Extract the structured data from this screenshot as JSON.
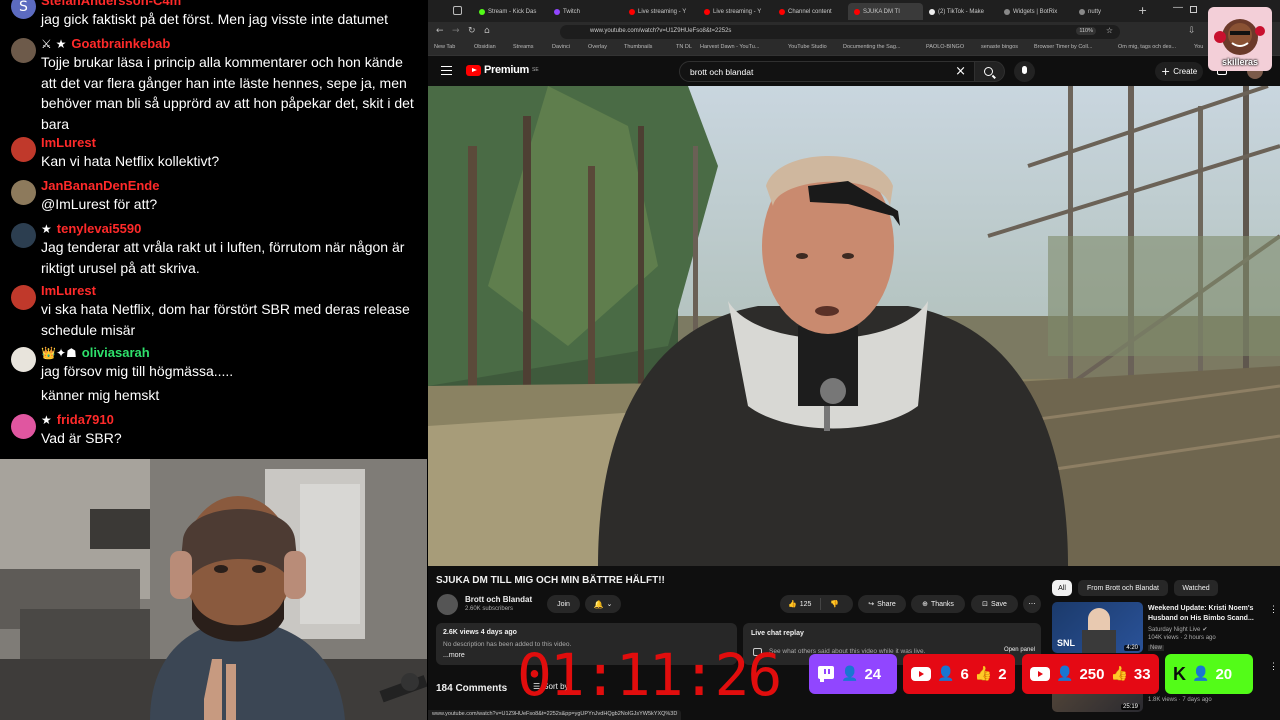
{
  "chat": {
    "messages": [
      {
        "username": "StefanAndersson-C4m",
        "avatar_letter": "S",
        "badges": "",
        "color": "#ff2a2a",
        "lines": [
          "jag gick faktiskt på det först. Men jag visste inte datumet"
        ]
      },
      {
        "username": "Goatbrainkebab",
        "badges": "⚔ ★",
        "color": "#ff2a2a",
        "lines": [
          "Tojje brukar läsa i princip alla kommentarer och hon kände att det var flera gånger han inte läste hennes, sepe ja, men behöver man bli så upprörd av att hon påpekar det, skit i det bara"
        ]
      },
      {
        "username": "ImLurest",
        "badges": "",
        "color": "#ff2a2a",
        "lines": [
          "Kan vi hata Netflix kollektivt?"
        ]
      },
      {
        "username": "JanBananDenEnde",
        "badges": "",
        "color": "#ff2a2a",
        "lines": [
          "@ImLurest för att?"
        ]
      },
      {
        "username": "tenylevai5590",
        "badges": "★",
        "color": "#ff2a2a",
        "lines": [
          "Jag tenderar att vråla rakt ut i luften, förrutom när någon är riktigt urusel på att skriva."
        ]
      },
      {
        "username": "ImLurest",
        "badges": "",
        "color": "#ff2a2a",
        "lines": [
          "vi ska hata Netflix, dom har förstört SBR med deras release schedule misär"
        ]
      },
      {
        "username": "oliviasarah",
        "badges": "👑✦☗",
        "color": "#2ee06b",
        "lines": [
          "jag försov mig till högmässa.....",
          "känner mig hemskt"
        ]
      },
      {
        "username": "frida7910",
        "badges": "★",
        "color": "#ff2a2a",
        "lines": [
          "Vad är SBR?"
        ]
      }
    ]
  },
  "browser": {
    "tabs": [
      {
        "label": "Stream - Kick Das",
        "color": "#53fc18"
      },
      {
        "label": "Twitch",
        "color": "#9146ff"
      },
      {
        "label": "Live streaming - Y",
        "color": "#ff0000"
      },
      {
        "label": "Live streaming - Y",
        "color": "#ff0000"
      },
      {
        "label": "Channel content",
        "color": "#ff0000"
      },
      {
        "label": "SJUKA DM TI",
        "color": "#ff0000"
      },
      {
        "label": "(2) TikTok - Make",
        "color": "#eeeeee"
      },
      {
        "label": "Widgets | BotRix",
        "color": "#888888"
      },
      {
        "label": "nutty",
        "color": "#888888"
      }
    ],
    "url": "www.youtube.com/watch?v=U1Z9HUeFso8&t=2252s",
    "zoom": "110%",
    "bookmarks": [
      "New Tab",
      "Obsidian",
      "Streams",
      "Davinci",
      "Overlay",
      "Thumbnails",
      "TN DL",
      "Harvest Dawn - YouTu...",
      "YouTube Studio",
      "Documenting the Sag...",
      "PAOLO-BINGO",
      "senaste bingos",
      "Browser Timer by Coll...",
      "Om mig, tags och des...",
      "You"
    ]
  },
  "youtube": {
    "logo": "Premium",
    "logo_sup": "SE",
    "search_value": "brott och blandat",
    "create_label": "Create",
    "video_title": "SJUKA DM TILL MIG OCH MIN BÄTTRE HÄLFT!!",
    "channel_name": "Brott och Blandat",
    "subscribers": "2.60K subscribers",
    "join_label": "Join",
    "likes": "125",
    "share_label": "Share",
    "thanks_label": "Thanks",
    "save_label": "Save",
    "desc_meta": "2.6K views  4 days ago",
    "desc_text": "No description has been added to this video.",
    "desc_more": "...more",
    "live_chat_replay": "Live chat replay",
    "live_chat_sub": "See what others said about this video while it was live.",
    "open_panel": "Open panel",
    "comments_count": "184 Comments",
    "sort_by": "Sort by",
    "chips": [
      "All",
      "From Brott och Blandat",
      "Watched"
    ],
    "recommended": [
      {
        "title": "Weekend Update: Kristi Noem's Husband on His Bimbo Scand...",
        "channel": "Saturday Night Live",
        "meta": "104K views · 2 hours ago",
        "badge": "New",
        "duration": "4:20"
      },
      {
        "title": "",
        "channel": "",
        "meta": "1.8K views · 7 days ago",
        "badge": "",
        "duration": "25:19"
      }
    ],
    "status_url": "www.youtube.com/watch?v=U1Z9HUeFso8&t=2252s&pp=ygUPYnJvdHQgb2NoIGJsYW5kYXQ%3D"
  },
  "overlay": {
    "timer": "01:11:26",
    "stats": [
      {
        "platform": "twitch",
        "viewers": "24",
        "likes": ""
      },
      {
        "platform": "youtube",
        "viewers": "6",
        "likes": "2"
      },
      {
        "platform": "youtube",
        "viewers": "250",
        "likes": "33"
      },
      {
        "platform": "kick",
        "viewers": "20",
        "likes": ""
      }
    ],
    "profile_name": "skilleras"
  },
  "colors": {
    "twitch": "#9146ff",
    "youtube_red": "#e50914",
    "kick": "#53fc18",
    "timer": "#e10d0d"
  }
}
